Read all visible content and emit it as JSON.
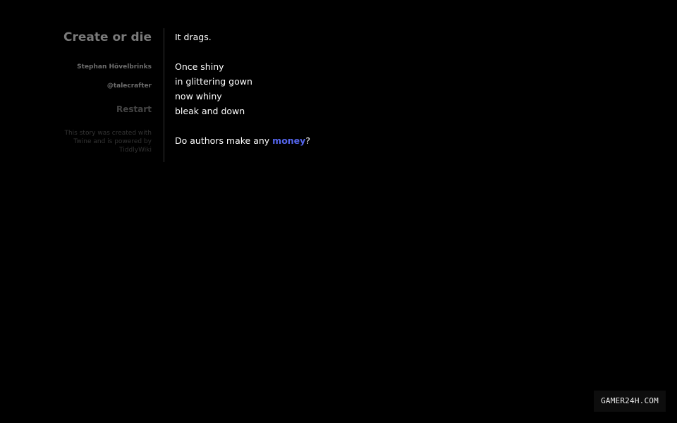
{
  "sidebar": {
    "title": "Create or die",
    "author": "Stephan Hövelbrinks",
    "handle": "@talecrafter",
    "restart_label": "Restart",
    "credits": "This story was created with Twine and is powered by TiddlyWiki"
  },
  "passage": {
    "line1": "It drags.",
    "poem": [
      "Once shiny",
      "in glittering gown",
      "now whiny",
      "bleak and down"
    ],
    "question_prefix": "Do authors make any ",
    "question_link": "money",
    "question_suffix": "?"
  },
  "watermark": "GAMER24H.COM",
  "colors": {
    "background": "#000000",
    "text": "#ffffff",
    "link": "#5566ee",
    "sidebar_title": "#7a7a7a"
  }
}
